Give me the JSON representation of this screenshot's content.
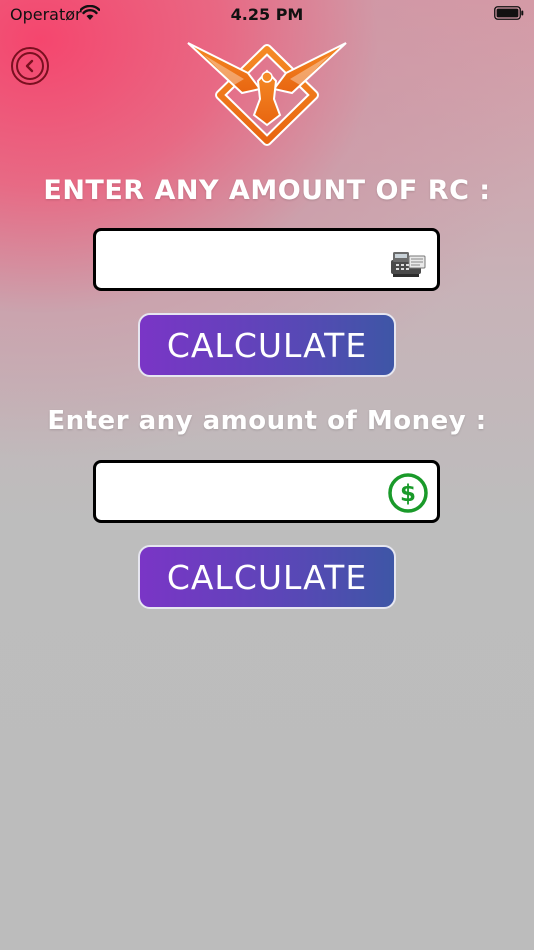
{
  "status_bar": {
    "carrier": "Operatør",
    "time": "4.25 PM"
  },
  "icons": {
    "back": "chevron-left-icon",
    "logo": "eagle-logo-icon",
    "rc": "cash-register-icon",
    "money": "dollar-icon",
    "wifi": "wifi-icon",
    "battery": "battery-icon"
  },
  "colors": {
    "button_gradient_start": "#7a35c6",
    "button_gradient_end": "#3e56a6",
    "back_ring": "#7a1020",
    "logo_orange": "#f07a1a",
    "dollar_green": "#1a9a2a"
  },
  "rc_section": {
    "label": "ENTER ANY AMOUNT OF RC :",
    "input_value": "",
    "button_label": "CALCULATE"
  },
  "money_section": {
    "label": "Enter any amount of Money :",
    "input_value": "",
    "button_label": "CALCULATE"
  }
}
